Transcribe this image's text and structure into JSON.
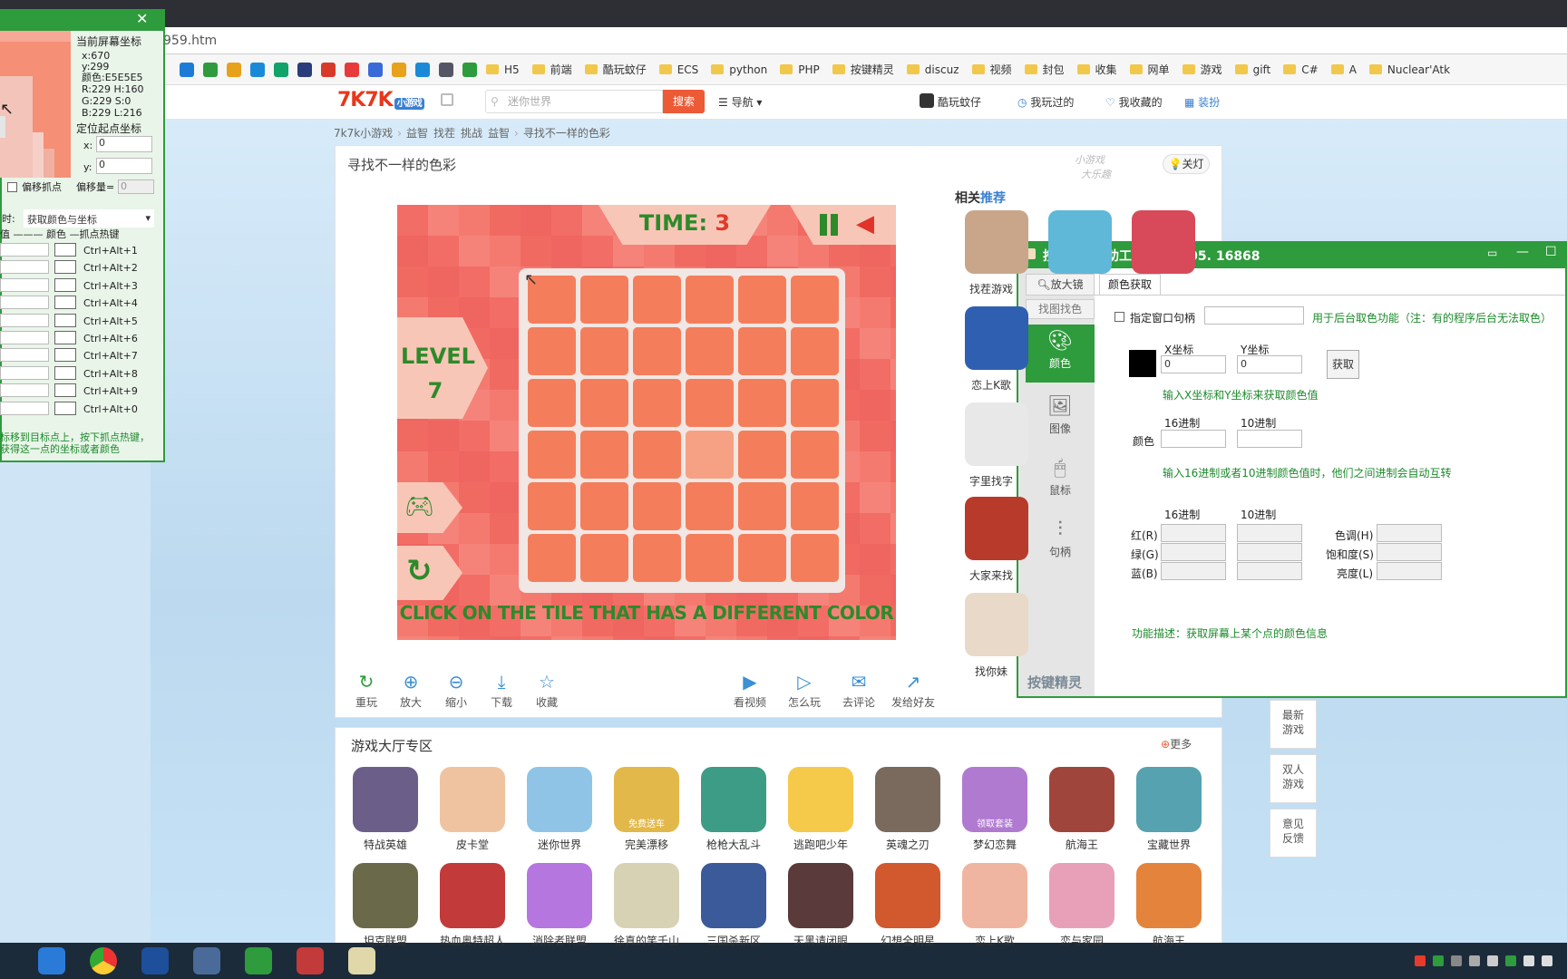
{
  "browser": {
    "url": "959.htm",
    "bookmarks": [
      "H5",
      "前端",
      "酷玩蚊仔",
      "ECS",
      "python",
      "PHP",
      "按键精灵",
      "discuz",
      "视频",
      "封包",
      "收集",
      "网单",
      "游戏",
      "gift",
      "C#",
      "A",
      "Nuclear'Atk"
    ]
  },
  "site": {
    "logo": "7K7K",
    "logo_sub": "小游戏",
    "search_placeholder": "迷你世界",
    "search_button": "搜索",
    "nav_label": "导航",
    "user_name": "酷玩蚊仔",
    "played": "我玩过的",
    "favorites": "我收藏的",
    "dress": "装扮",
    "breadcrumb": [
      "7k7k小游戏",
      "益智",
      "找茬",
      "挑战",
      "益智",
      "寻找不一样的色彩"
    ]
  },
  "game": {
    "title": "寻找不一样的色彩",
    "lights_button": "关灯",
    "time_label": "TIME:",
    "time_value": "3",
    "level_label": "LEVEL",
    "level_value": "7",
    "instruction": "CLICK ON THE TILE THAT HAS A DIFFERENT COLOR",
    "tile_color": "#f47e5b",
    "odd_tile_color": "#f7a184",
    "odd_tile": {
      "row": 4,
      "col": 4
    }
  },
  "game_toolbar": [
    "重玩",
    "放大",
    "缩小",
    "下载",
    "收藏",
    "看视频",
    "怎么玩",
    "去评论",
    "发给好友"
  ],
  "recommend": {
    "title_a": "相关",
    "title_b": "推荐",
    "items": [
      "找茬游戏",
      "恋上K歌",
      "字里找字",
      "大家来找",
      "找你妹"
    ]
  },
  "hall": {
    "title": "游戏大厅专区",
    "more": "更多",
    "row1": [
      {
        "name": "特战英雄",
        "color": "#6b5f8a"
      },
      {
        "name": "皮卡堂",
        "color": "#f0c3a0"
      },
      {
        "name": "迷你世界",
        "color": "#8fc4e6"
      },
      {
        "name": "完美漂移",
        "color": "#e2b84a",
        "badge": "免费送车"
      },
      {
        "name": "枪枪大乱斗",
        "color": "#3d9c86"
      },
      {
        "name": "逃跑吧少年",
        "color": "#f5c94a"
      },
      {
        "name": "英魂之刃",
        "color": "#7a6a5e"
      },
      {
        "name": "梦幻恋舞",
        "color": "#b07ad0",
        "badge": "领取套装"
      },
      {
        "name": "航海王",
        "color": "#a0453c"
      },
      {
        "name": "宝藏世界",
        "color": "#56a2b0"
      }
    ],
    "row2": [
      {
        "name": "坦克联盟",
        "color": "#6a6a4a"
      },
      {
        "name": "热血奥特超人",
        "color": "#c23a3a"
      },
      {
        "name": "消除者联盟",
        "color": "#b676e0"
      },
      {
        "name": "徐真的笑千山",
        "color": "#d8d2b4"
      },
      {
        "name": "三国杀新区",
        "color": "#3a5a9a"
      },
      {
        "name": "天黑请闭眼",
        "color": "#5a3a3a"
      },
      {
        "name": "幻想全明星",
        "color": "#d2582e"
      },
      {
        "name": "恋上K歌",
        "color": "#f0b5a0"
      },
      {
        "name": "恋与家园",
        "color": "#e8a0b8"
      },
      {
        "name": "航海王",
        "color": "#e4843c"
      }
    ]
  },
  "side_float": [
    "最新游戏",
    "双人游戏",
    "意见反馈"
  ],
  "left_tool": {
    "screen_coord_label": "当前屏幕坐标",
    "x": "x:670",
    "y": "y:299",
    "color": "颜色:E5E5E5",
    "r": "R:229 H:160",
    "g": "G:229 S:0",
    "b": "B:229 L:216",
    "anchor_label": "定位起点坐标",
    "ax_label": "x:",
    "ax": "0",
    "ay_label": "y:",
    "ay": "0",
    "offset_check": "偏移抓点",
    "offset_label": "偏移量=",
    "offset_val": "0",
    "mode_label": "时:",
    "mode": "获取颜色与坐标",
    "col_headers": "值 ——— 颜色 —抓点热键",
    "hotkeys": [
      "Ctrl+Alt+1",
      "Ctrl+Alt+2",
      "Ctrl+Alt+3",
      "Ctrl+Alt+4",
      "Ctrl+Alt+5",
      "Ctrl+Alt+6",
      "Ctrl+Alt+7",
      "Ctrl+Alt+8",
      "Ctrl+Alt+9",
      "Ctrl+Alt+0"
    ],
    "hint1": "标移到目标点上，按下抓点热键，",
    "hint2": "获得这一点的坐标或者颜色"
  },
  "right_tool": {
    "title": "按键抓抓辅助工具2014. 05. 16868",
    "tab_magnifier": "放大镜",
    "tab_find": "找图找色",
    "tab_color": "颜色获取",
    "nav": [
      "颜色",
      "图像",
      "鼠标",
      "句柄"
    ],
    "window_handle": "指定窗口句柄",
    "bg_note": "用于后台取色功能（注：有的程序后台无法取色）",
    "x_label": "X坐标",
    "y_label": "Y坐标",
    "x_val": "0",
    "y_val": "0",
    "get_button": "获取",
    "hint_xy": "输入X坐标和Y坐标来获取颜色值",
    "hex_label": "16进制",
    "dec_label": "10进制",
    "color_label": "颜色",
    "hint_hex": "输入16进制或者10进制颜色值时，他们之间进制会自动互转",
    "red": "红(R)",
    "green": "绿(G)",
    "blue": "蓝(B)",
    "hue": "色调(H)",
    "sat": "饱和度(S)",
    "lum": "亮度(L)",
    "desc": "功能描述：获取屏幕上某个点的颜色信息",
    "brand": "按键精灵"
  }
}
